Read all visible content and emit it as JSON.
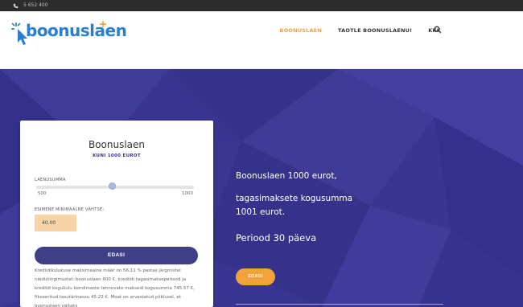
{
  "topbar": {
    "phone": "5 652 400",
    "phone_icon": "phone-icon"
  },
  "header": {
    "logo_text": "boonuslaen",
    "logo_icon": "cursor-click-icon",
    "nav": [
      {
        "label": "BOONUSLAEN",
        "active": true
      },
      {
        "label": "TAOTLE BOONUSLAENU!",
        "active": false
      },
      {
        "label": "KKK",
        "active": false
      }
    ],
    "search_icon": "search-icon",
    "accent_color": "#f0a23c",
    "brand_color": "#2a7fd1"
  },
  "card": {
    "title": "Boonuslaen",
    "subtitle": "KUNI 1000 EUROT",
    "amount_label": "LAENUSUMMA",
    "slider": {
      "min": "500",
      "max": "1000",
      "level": 0.48
    },
    "min_payment_label": "ESIMENE MINIMAALNE VAHTSE:",
    "min_payment_value": "40.00",
    "button": "EDASI",
    "disclaimer": "Krediidikulukuse maksimaalne määr on 56.11 % pastas järgmistel näidistingimustel: boonuslaen 600 €, krediidi tagasimakseperiood ja krediidi kogukulu kondimaste tehnovate makseid kogusumma 745.57 €, fikseeritud tasutärinessu 45.22 €. Moat on arvestatud piiblusel, et boonuslaen väitaks"
  },
  "hero": {
    "line1": "Boonuslaen 1000 eurot,",
    "line2": "tagasimaksete kogusumma",
    "line3": "1001 eurot.",
    "period": "Periood 30 päeva",
    "button": "EDASI",
    "bg_color": "#3a3591",
    "button_color": "#f1a33a"
  }
}
